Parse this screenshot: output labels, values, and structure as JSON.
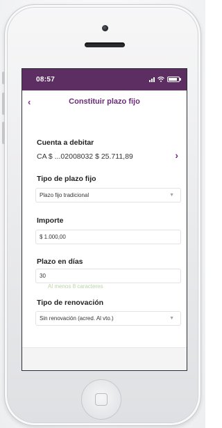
{
  "status": {
    "time": "08:57"
  },
  "nav": {
    "back_icon": "‹",
    "title": "Constituir plazo fijo"
  },
  "debit": {
    "label": "Cuenta a debitar",
    "account": "CA $ ...02008032 $ 25.711,89",
    "chevron": "›"
  },
  "term_type": {
    "label": "Tipo de plazo fijo",
    "value": "Plazo fijo tradicional",
    "caret": "▼"
  },
  "amount": {
    "label": "Importe",
    "value": "$ 1.000,00"
  },
  "days": {
    "label": "Plazo en días",
    "value": "30",
    "hint": "Al menos 8 caracteres"
  },
  "renewal": {
    "label": "Tipo de renovación",
    "value": "Sin renovación (acred. Al vto.)",
    "caret": "▼"
  },
  "colors": {
    "brand_purple": "#5c2e62",
    "accent_purple": "#6b2a77",
    "hint_green": "#b9d5a6"
  }
}
